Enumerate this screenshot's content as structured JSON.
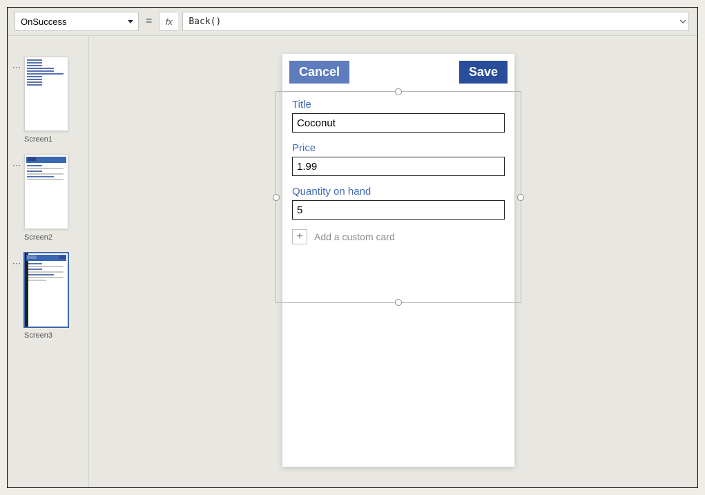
{
  "formulaBar": {
    "property": "OnSuccess",
    "fx": "fx",
    "equals": "=",
    "formula": "Back()"
  },
  "nav": {
    "screens": [
      {
        "label": "Screen1"
      },
      {
        "label": "Screen2"
      },
      {
        "label": "Screen3"
      }
    ]
  },
  "phone": {
    "cancel": "Cancel",
    "save": "Save",
    "fields": [
      {
        "label": "Title",
        "value": "Coconut"
      },
      {
        "label": "Price",
        "value": "1.99"
      },
      {
        "label": "Quantity on hand",
        "value": "5"
      }
    ],
    "addCustom": "Add a custom card"
  }
}
